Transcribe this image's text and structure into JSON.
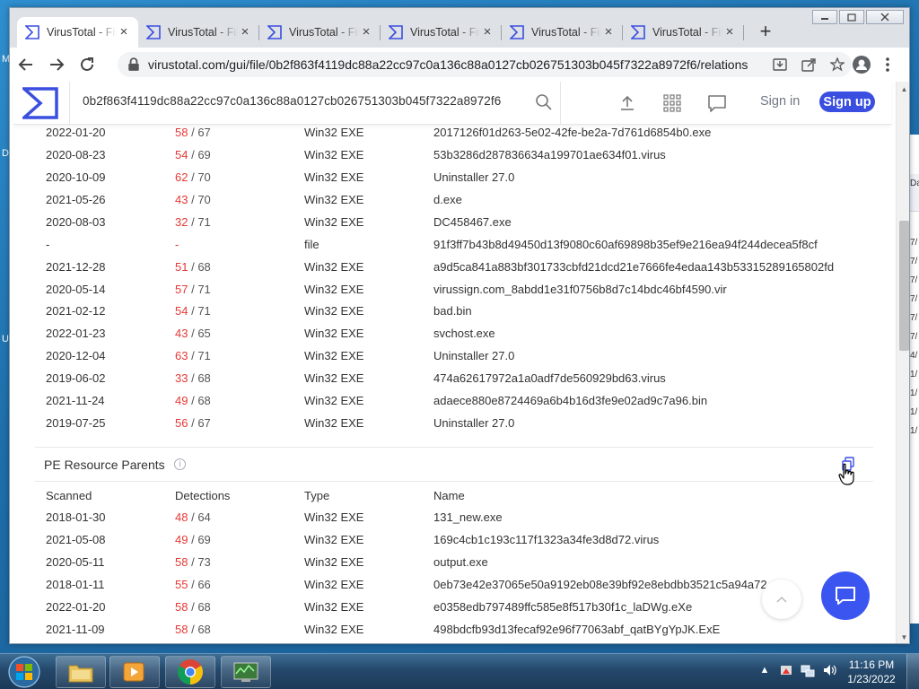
{
  "desktop": {
    "left_glyphs": [
      "M",
      "D",
      "U"
    ]
  },
  "peek_window": {
    "header": "Da",
    "rows": [
      "7/",
      "7/",
      "7/",
      "7/",
      "7/",
      "7/",
      "4/",
      "1/",
      "1/",
      "1/",
      "1/"
    ]
  },
  "browser": {
    "tabs": [
      {
        "title": "VirusTotal - File",
        "active": true
      },
      {
        "title": "VirusTotal - File",
        "active": false
      },
      {
        "title": "VirusTotal - File",
        "active": false
      },
      {
        "title": "VirusTotal - File",
        "active": false
      },
      {
        "title": "VirusTotal - File",
        "active": false
      },
      {
        "title": "VirusTotal - File",
        "active": false
      }
    ],
    "url": "virustotal.com/gui/file/0b2f863f4119dc88a22cc97c0a136c88a0127cb026751303b045f7322a8972f6/relations"
  },
  "vt_header": {
    "search_value": "0b2f863f4119dc88a22cc97c0a136c88a0127cb026751303b045f7322a8972f6",
    "signin_label": "Sign in",
    "signup_label": "Sign up"
  },
  "prev_table": {
    "partial_row": {
      "date": "2022-01-20",
      "det": "58",
      "tot": "67",
      "type": "Win32 EXE",
      "name": "2017126f01d263-5e02-42fe-be2a-7d761d6854b0.exe"
    },
    "rows": [
      {
        "date": "2020-08-23",
        "det": "54",
        "tot": "69",
        "type": "Win32 EXE",
        "name": "53b3286d287836634a199701ae634f01.virus"
      },
      {
        "date": "2020-10-09",
        "det": "62",
        "tot": "70",
        "type": "Win32 EXE",
        "name": "Uninstaller 27.0"
      },
      {
        "date": "2021-05-26",
        "det": "43",
        "tot": "70",
        "type": "Win32 EXE",
        "name": "d.exe"
      },
      {
        "date": "2020-08-03",
        "det": "32",
        "tot": "71",
        "type": "Win32 EXE",
        "name": "DC458467.exe"
      },
      {
        "date": "-",
        "det": "-",
        "tot": "",
        "type": "file",
        "name": "91f3ff7b43b8d49450d13f9080c60af69898b35ef9e216ea94f244decea5f8cf"
      },
      {
        "date": "2021-12-28",
        "det": "51",
        "tot": "68",
        "type": "Win32 EXE",
        "name": "a9d5ca841a883bf301733cbfd21dcd21e7666fe4edaa143b53315289165802fd"
      },
      {
        "date": "2020-05-14",
        "det": "57",
        "tot": "71",
        "type": "Win32 EXE",
        "name": "virussign.com_8abdd1e31f0756b8d7c14bdc46bf4590.vir"
      },
      {
        "date": "2021-02-12",
        "det": "54",
        "tot": "71",
        "type": "Win32 EXE",
        "name": "bad.bin"
      },
      {
        "date": "2022-01-23",
        "det": "43",
        "tot": "65",
        "type": "Win32 EXE",
        "name": "svchost.exe"
      },
      {
        "date": "2020-12-04",
        "det": "63",
        "tot": "71",
        "type": "Win32 EXE",
        "name": "Uninstaller 27.0"
      },
      {
        "date": "2019-06-02",
        "det": "33",
        "tot": "68",
        "type": "Win32 EXE",
        "name": "474a62617972a1a0adf7de560929bd63.virus"
      },
      {
        "date": "2021-11-24",
        "det": "49",
        "tot": "68",
        "type": "Win32 EXE",
        "name": "adaece880e8724469a6b4b16d3fe9e02ad9c7a96.bin"
      },
      {
        "date": "2019-07-25",
        "det": "56",
        "tot": "67",
        "type": "Win32 EXE",
        "name": "Uninstaller 27.0"
      }
    ]
  },
  "pe_section": {
    "title": "PE Resource Parents",
    "info_glyph": "i",
    "columns": [
      "Scanned",
      "Detections",
      "Type",
      "Name"
    ],
    "rows": [
      {
        "date": "2018-01-30",
        "det": "48",
        "tot": "64",
        "type": "Win32 EXE",
        "name": "131_new.exe"
      },
      {
        "date": "2021-05-08",
        "det": "49",
        "tot": "69",
        "type": "Win32 EXE",
        "name": "169c4cb1c193c117f1323a34fe3d8d72.virus"
      },
      {
        "date": "2020-05-11",
        "det": "58",
        "tot": "73",
        "type": "Win32 EXE",
        "name": "output.exe"
      },
      {
        "date": "2018-01-11",
        "det": "55",
        "tot": "66",
        "type": "Win32 EXE",
        "name": "0eb73e42e37065e50a9192eb08e39bf92e8ebdbb3521c5a94a72"
      },
      {
        "date": "2022-01-20",
        "det": "58",
        "tot": "68",
        "type": "Win32 EXE",
        "name": "e0358edb797489ffc585e8f517b30f1c_laDWg.eXe"
      },
      {
        "date": "2021-11-09",
        "det": "58",
        "tot": "68",
        "type": "Win32 EXE",
        "name": "498bdcfb93d13fecaf92e96f77063abf_qatBYgYpJK.ExE"
      }
    ]
  },
  "taskbar": {
    "time": "11:16 PM",
    "date": "1/23/2022"
  },
  "colors": {
    "accent": "#3b56f0",
    "detection_red": "#e53935"
  }
}
